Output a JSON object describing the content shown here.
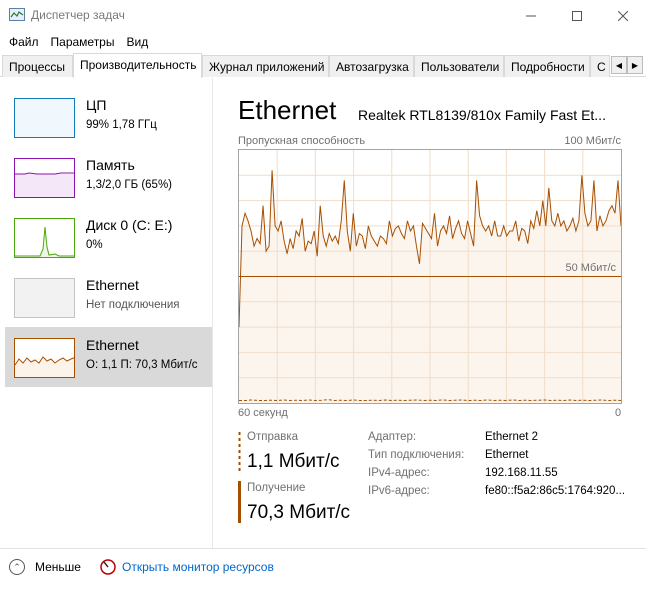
{
  "window": {
    "title": "Диспетчер задач",
    "minimize_icon": "minimize-icon",
    "maximize_icon": "maximize-icon",
    "close_icon": "close-icon"
  },
  "menu": [
    "Файл",
    "Параметры",
    "Вид"
  ],
  "tabs": [
    {
      "label": "Процессы",
      "active": false
    },
    {
      "label": "Производительность",
      "active": true
    },
    {
      "label": "Журнал приложений",
      "active": false
    },
    {
      "label": "Автозагрузка",
      "active": false
    },
    {
      "label": "Пользователи",
      "active": false
    },
    {
      "label": "Подробности",
      "active": false
    },
    {
      "label": "С",
      "active": false
    }
  ],
  "tab_scroll": {
    "left": "◀",
    "right": "▶"
  },
  "sidebar": [
    {
      "name": "ЦП",
      "detail": "99%  1,78 ГГц",
      "color": "#117dbb",
      "selected": false
    },
    {
      "name": "Память",
      "detail": "1,3/2,0 ГБ (65%)",
      "color": "#8b12ae",
      "selected": false
    },
    {
      "name": "Диск 0 (C: E:)",
      "detail": "0%",
      "color": "#4da60c",
      "selected": false
    },
    {
      "name": "Ethernet",
      "detail": "Нет подключения",
      "color": "#a7a7a7",
      "selected": false
    },
    {
      "name": "Ethernet",
      "detail": "О: 1,1  П: 70,3 Мбит/с",
      "color": "#a74f01",
      "selected": true
    }
  ],
  "main": {
    "title": "Ethernet",
    "subtitle": "Realtek RTL8139/810x Family Fast Et...",
    "graph": {
      "label": "Пропускная способность",
      "max_label": "100 Мбит/с",
      "mid_label": "50 Мбит/с",
      "time_left": "60 секунд",
      "time_right": "0",
      "line_color": "#a74f01",
      "fill_color": "#fcf3eb",
      "grid_color": "#f1ddc8",
      "receive_values": [
        30,
        70,
        75,
        72,
        68,
        62,
        65,
        63,
        78,
        60,
        62,
        92,
        70,
        68,
        72,
        64,
        59,
        65,
        61,
        68,
        66,
        73,
        60,
        64,
        63,
        68,
        58,
        78,
        66,
        62,
        67,
        64,
        66,
        63,
        72,
        88,
        68,
        60,
        75,
        62,
        67,
        66,
        61,
        70,
        66,
        64,
        62,
        66,
        65,
        63,
        72,
        66,
        69,
        70,
        67,
        65,
        72,
        68,
        70,
        62,
        55,
        71,
        69,
        67,
        65,
        75,
        62,
        68,
        70,
        67,
        74,
        65,
        69,
        72,
        67,
        65,
        72,
        67,
        62,
        88,
        74,
        70,
        68,
        70,
        66,
        72,
        66,
        66,
        70,
        66,
        68,
        68,
        72,
        64,
        69,
        68,
        63,
        72,
        69,
        76,
        70,
        80,
        70,
        85,
        72,
        70,
        75,
        70,
        72,
        68,
        70,
        73,
        68,
        72,
        90,
        75,
        70,
        72,
        88,
        68,
        74,
        70,
        72,
        76,
        78,
        75,
        88,
        70
      ],
      "send_values": [
        1,
        1,
        1.2,
        1,
        1,
        1.1,
        1,
        1.2,
        1,
        1.1,
        1,
        1.2,
        1,
        1.1,
        1.3,
        1,
        1.1,
        1,
        1.2,
        1,
        1,
        1.1,
        1,
        1.2,
        1,
        1.1,
        1,
        1.1,
        1.2,
        1,
        1.1,
        1,
        1.2,
        1,
        1.1,
        1.2,
        1,
        1.1,
        1,
        1.2,
        1,
        1.1,
        1,
        1.2,
        1,
        1.1,
        1,
        1.1,
        1.2,
        1,
        1.1,
        1,
        1.2,
        1,
        1.1,
        1,
        1.1,
        1.2,
        1,
        1.1,
        1
      ]
    },
    "send": {
      "label": "Отправка",
      "value": "1,1 Мбит/с"
    },
    "receive": {
      "label": "Получение",
      "value": "70,3 Мбит/с"
    },
    "info": [
      {
        "label": "Адаптер:",
        "value": "Ethernet 2"
      },
      {
        "label": "Тип подключения:",
        "value": "Ethernet"
      },
      {
        "label": "IPv4-адрес:",
        "value": "192.168.11.55"
      },
      {
        "label": "IPv6-адрес:",
        "value": "fe80::f5a2:86c5:1764:920..."
      }
    ]
  },
  "footer": {
    "fewer_label": "Меньше",
    "fewer_icon": "chevron-up-circle-icon",
    "monitor_label": "Открыть монитор ресурсов",
    "monitor_icon": "resource-monitor-icon"
  }
}
